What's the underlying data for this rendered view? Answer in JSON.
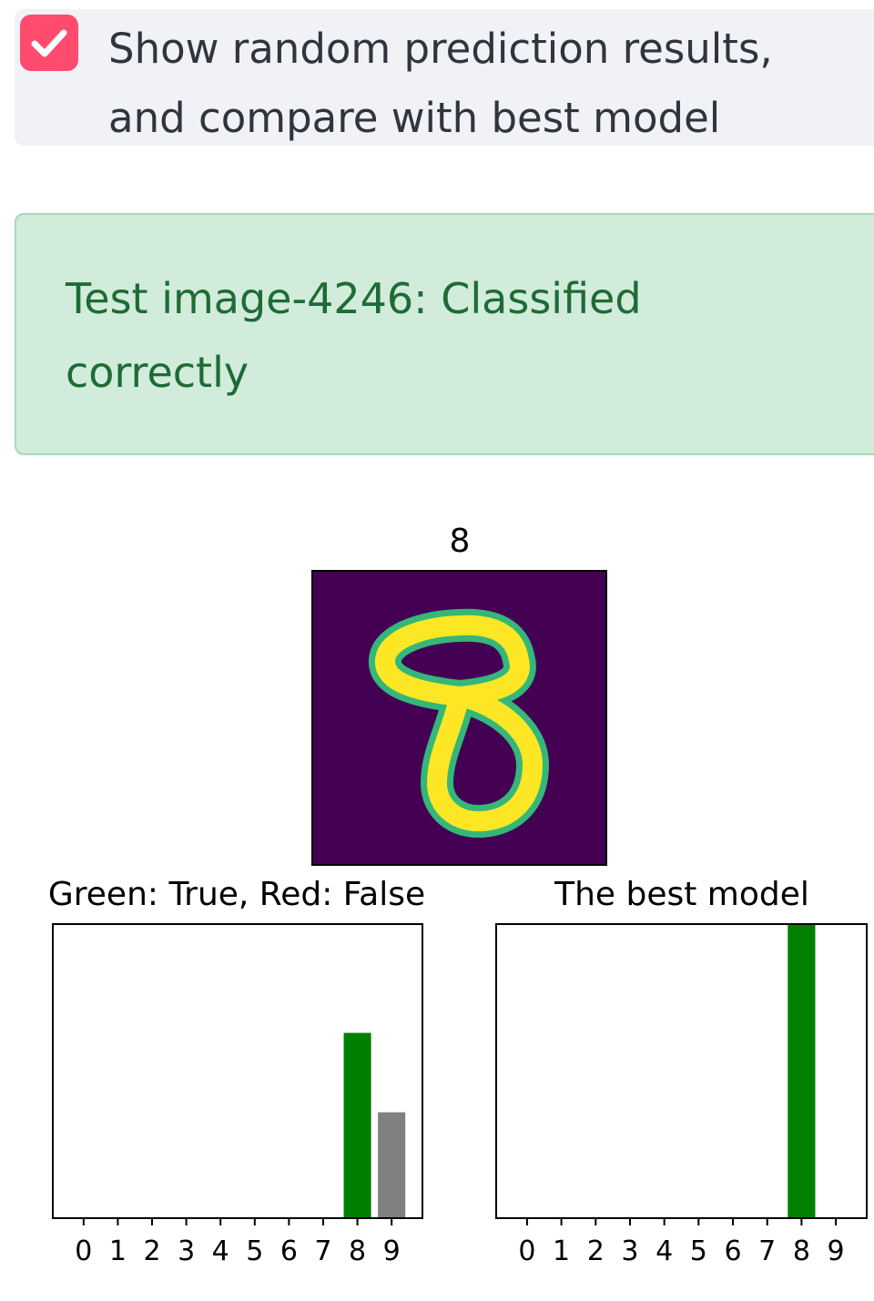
{
  "checkbox": {
    "checked": true,
    "label": "Show random prediction results, and compare with best model",
    "accent": "#ff4b6e"
  },
  "alert": {
    "type": "success",
    "text": "Test image-4246: Classified correctly",
    "background": "#d1ecdb",
    "text_color": "#1e6b35"
  },
  "image_panel": {
    "title": "8",
    "colormap": "viridis",
    "depicts": "handwritten digit 8"
  },
  "chart_data": [
    {
      "type": "bar",
      "title": "Green: True, Red: False",
      "categories": [
        "0",
        "1",
        "2",
        "3",
        "4",
        "5",
        "6",
        "7",
        "8",
        "9"
      ],
      "values": [
        0,
        0,
        0,
        0,
        0,
        0,
        0,
        0.003,
        0.63,
        0.36
      ],
      "bar_colors": [
        "#808080",
        "#808080",
        "#808080",
        "#808080",
        "#808080",
        "#808080",
        "#808080",
        "#808080",
        "#008000",
        "#808080"
      ],
      "ylim": [
        0,
        1
      ],
      "grid": false,
      "yticks_visible": false
    },
    {
      "type": "bar",
      "title": "The best model",
      "categories": [
        "0",
        "1",
        "2",
        "3",
        "4",
        "5",
        "6",
        "7",
        "8",
        "9"
      ],
      "values": [
        0,
        0,
        0,
        0,
        0,
        0,
        0,
        0,
        1.0,
        0
      ],
      "bar_colors": [
        "#808080",
        "#808080",
        "#808080",
        "#808080",
        "#808080",
        "#808080",
        "#808080",
        "#808080",
        "#008000",
        "#808080"
      ],
      "ylim": [
        0,
        1
      ],
      "grid": false,
      "yticks_visible": false
    }
  ]
}
